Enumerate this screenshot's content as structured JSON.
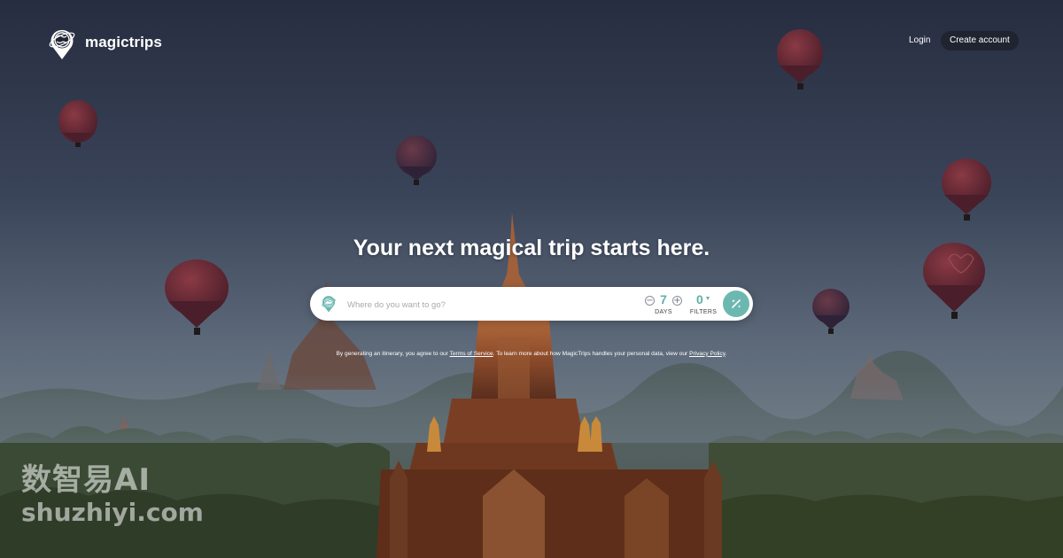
{
  "brand": {
    "name": "magictrips",
    "logo_icon": "globe-pin-icon"
  },
  "nav": {
    "login_label": "Login",
    "create_account_label": "Create account"
  },
  "hero": {
    "headline": "Your next magical trip starts here."
  },
  "search": {
    "placeholder": "Where do you want to go?",
    "globe_icon": "globe-icon",
    "days": {
      "value": "7",
      "label": "DAYS",
      "minus_icon": "minus-circle-icon",
      "plus_icon": "plus-circle-icon"
    },
    "filters": {
      "value": "0",
      "label": "FILTERS",
      "caret_icon": "caret-down-icon"
    },
    "generate_icon": "magic-wand-icon",
    "accent_color": "#6cb8b0"
  },
  "disclaimer": {
    "prefix": "By generating an itinerary, you agree to our ",
    "terms_label": "Terms of Service",
    "middle": ". To learn more about how MagicTrips handles your personal data, view our ",
    "privacy_label": "Privacy Policy",
    "suffix": "."
  },
  "watermark": {
    "line1": "数智易AI",
    "line2": "shuzhiyi.com"
  }
}
